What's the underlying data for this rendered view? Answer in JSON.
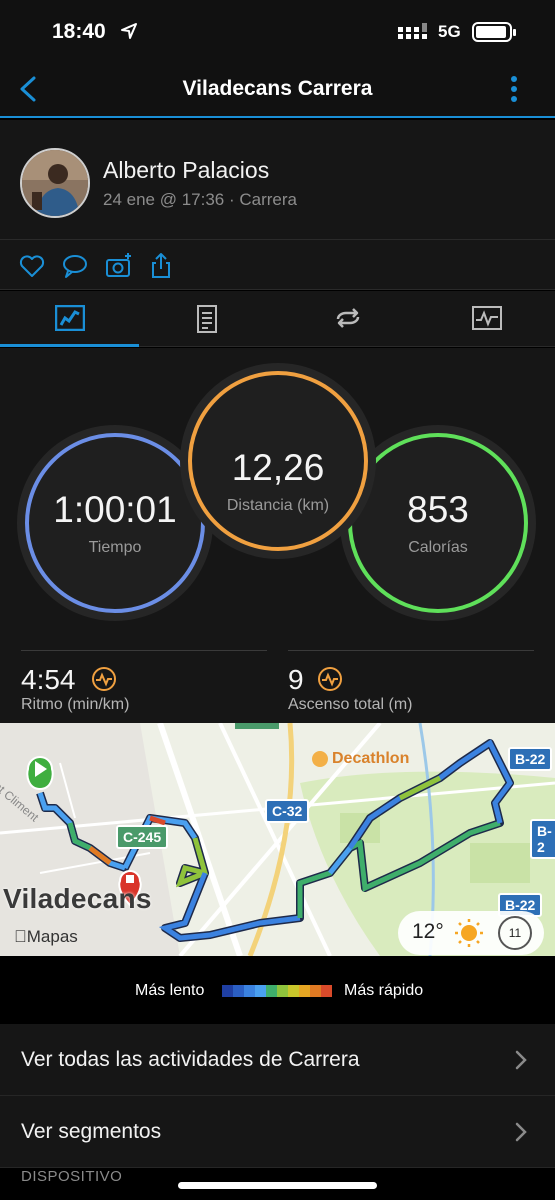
{
  "status_bar": {
    "time": "18:40",
    "network": "5G"
  },
  "nav": {
    "title": "Viladecans Carrera"
  },
  "profile": {
    "name": "Alberto Palacios",
    "meta": "24 ene @ 17:36 · Carrera"
  },
  "stats": {
    "time": {
      "value": "1:00:01",
      "label": "Tiempo"
    },
    "distance": {
      "value": "12,26",
      "label": "Distancia (km)"
    },
    "calories": {
      "value": "853",
      "label": "Calorías"
    },
    "pace": {
      "value": "4:54",
      "label": "Ritmo (min/km)"
    },
    "ascent": {
      "value": "9",
      "label": "Ascenso total (m)"
    }
  },
  "map": {
    "town": "Viladecans",
    "attribution": "Mapas",
    "poi": "Decathlon",
    "street": "nt Climent",
    "roads": [
      "C-245",
      "C-32",
      "B-22",
      "B-2",
      "B-22"
    ],
    "weather": {
      "temp": "12°",
      "aqi": "11"
    }
  },
  "legend": {
    "slow": "Más lento",
    "fast": "Más rápido",
    "colors": [
      "#1f3fa3",
      "#2b5fc4",
      "#3b82e0",
      "#4aa0f0",
      "#3fae6b",
      "#8fc33c",
      "#c9c62b",
      "#e6a623",
      "#e07a23",
      "#d94a2a"
    ]
  },
  "list": [
    {
      "label": "Ver todas las actividades de Carrera"
    },
    {
      "label": "Ver segmentos"
    }
  ],
  "section_title": "DISPOSITIVO",
  "colors": {
    "accent": "#1a8fd6",
    "time_ring": "#5b8de0",
    "distance_ring": "#f0a040",
    "calories_ring": "#5fe05a"
  }
}
